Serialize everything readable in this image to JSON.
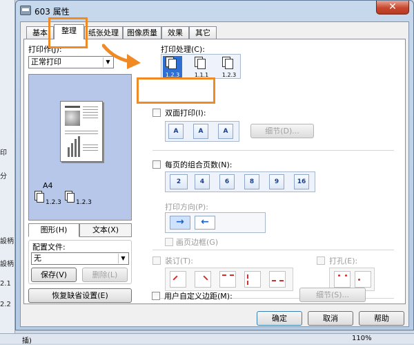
{
  "background": {
    "left_stubs": [
      "印",
      "分",
      "設柄",
      "設柄",
      "2.1",
      "2.2"
    ],
    "bottom_left": "插)",
    "zoom": "110%"
  },
  "window": {
    "title": "603 属性",
    "close_glyph": "✕"
  },
  "tabs": [
    {
      "label": "基本"
    },
    {
      "label": "整理"
    },
    {
      "label": "纸张处理"
    },
    {
      "label": "图像质量"
    },
    {
      "label": "效果"
    },
    {
      "label": "其它"
    }
  ],
  "left": {
    "print_job_label": "打印作(J):",
    "print_job_value": "正常打印",
    "paper_size": "A4",
    "stack_label_1": "1.2.3",
    "stack_label_2": "1.2.3",
    "view_graphic": "图形(H)",
    "view_text": "文本(X)",
    "profile_label": "配置文件:",
    "profile_value": "无",
    "save_button": "保存(V)",
    "delete_button": "删除(L)",
    "restore_button": "恢复缺省设置(E)"
  },
  "right": {
    "collate_label": "打印处理(C):",
    "collate_options": [
      "1.2.3",
      "1.1.1",
      "1.2.3"
    ],
    "duplex_label": "双面打印(I):",
    "duplex_details": "细节(D)...",
    "pages_per_sheet_label": "每页的组合页数(N):",
    "pages_per_sheet_options": [
      "2",
      "4",
      "6",
      "8",
      "9",
      "16"
    ],
    "direction_label": "打印方向(P):",
    "direction_arrows": [
      "→",
      "←"
    ],
    "border_label": "画页边框(G)",
    "staple_label": "装订(T):",
    "punch_label": "打孔(E):",
    "custom_margin_label": "用户自定义边距(M):",
    "custom_margin_details": "细节(S)..."
  },
  "buttons": {
    "ok": "确定",
    "cancel": "取消",
    "help": "帮助"
  },
  "colors": {
    "annotation": "#f08a24",
    "selected": "#2f6fd1",
    "close": "#c7482f"
  }
}
